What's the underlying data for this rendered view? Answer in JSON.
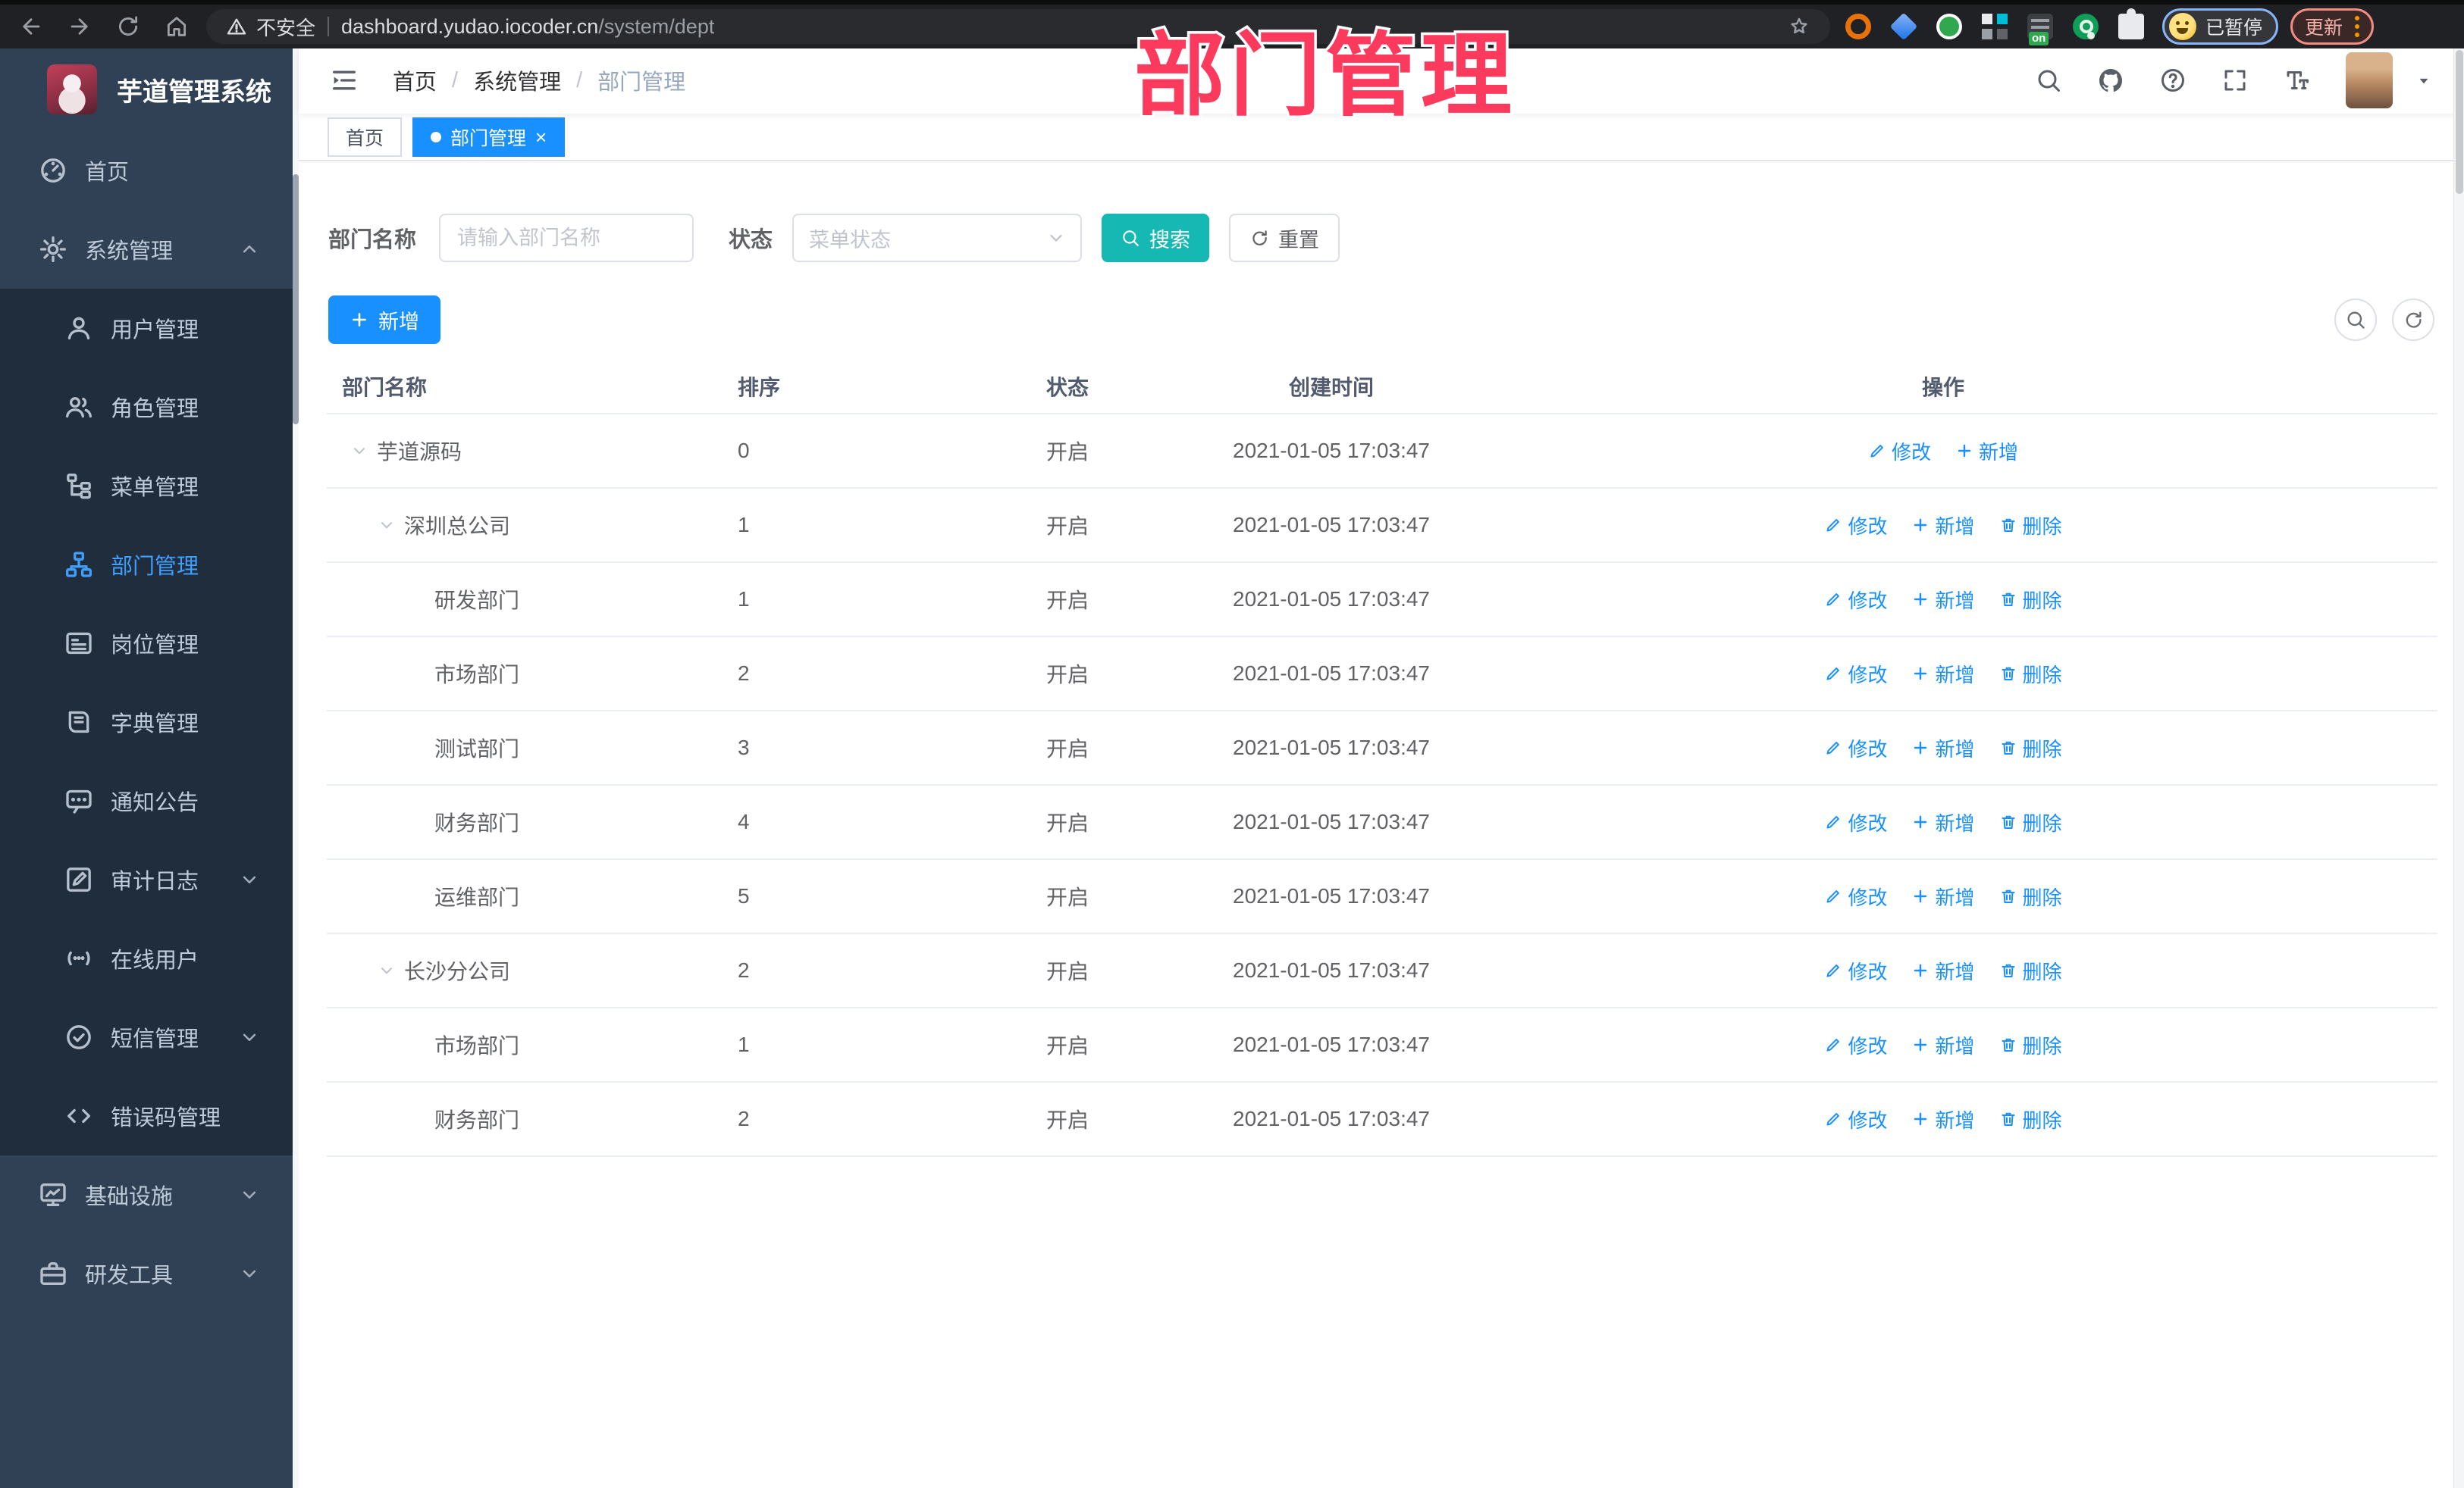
{
  "browser": {
    "security_label": "不安全",
    "url_host": "dashboard.yudao.iocoder.cn",
    "url_path": "/system/dept",
    "ext_badge": "on",
    "profile_status": "已暂停",
    "update_label": "更新"
  },
  "overlay": {
    "title": "部门管理"
  },
  "sidebar": {
    "title": "芋道管理系统",
    "items": [
      {
        "id": "home",
        "label": "首页",
        "icon": "dashboard",
        "type": "top",
        "active": false,
        "chevron": ""
      },
      {
        "id": "system",
        "label": "系统管理",
        "icon": "gear",
        "type": "top",
        "active": false,
        "chevron": "up"
      },
      {
        "id": "user",
        "label": "用户管理",
        "icon": "user",
        "type": "sub",
        "active": false,
        "chevron": ""
      },
      {
        "id": "role",
        "label": "角色管理",
        "icon": "users",
        "type": "sub",
        "active": false,
        "chevron": ""
      },
      {
        "id": "menu",
        "label": "菜单管理",
        "icon": "menutree",
        "type": "sub",
        "active": false,
        "chevron": ""
      },
      {
        "id": "dept",
        "label": "部门管理",
        "icon": "org",
        "type": "sub",
        "active": true,
        "chevron": ""
      },
      {
        "id": "post",
        "label": "岗位管理",
        "icon": "idcard",
        "type": "sub",
        "active": false,
        "chevron": ""
      },
      {
        "id": "dict",
        "label": "字典管理",
        "icon": "book",
        "type": "sub",
        "active": false,
        "chevron": ""
      },
      {
        "id": "notice",
        "label": "通知公告",
        "icon": "bubble",
        "type": "sub",
        "active": false,
        "chevron": ""
      },
      {
        "id": "audit",
        "label": "审计日志",
        "icon": "logedit",
        "type": "sub",
        "active": false,
        "chevron": "down"
      },
      {
        "id": "online",
        "label": "在线用户",
        "icon": "online",
        "type": "sub",
        "active": false,
        "chevron": ""
      },
      {
        "id": "sms",
        "label": "短信管理",
        "icon": "shieldcheck",
        "type": "sub",
        "active": false,
        "chevron": "down"
      },
      {
        "id": "errcode",
        "label": "错误码管理",
        "icon": "code",
        "type": "sub",
        "active": false,
        "chevron": ""
      },
      {
        "id": "infra",
        "label": "基础设施",
        "icon": "monitor",
        "type": "top",
        "active": false,
        "chevron": "down"
      },
      {
        "id": "tools",
        "label": "研发工具",
        "icon": "briefcase",
        "type": "top",
        "active": false,
        "chevron": "down"
      }
    ]
  },
  "header": {
    "breadcrumb": [
      "首页",
      "系统管理",
      "部门管理"
    ],
    "separator": "/"
  },
  "tags": {
    "items": [
      {
        "label": "首页",
        "active": false
      },
      {
        "label": "部门管理",
        "active": true
      }
    ],
    "close_glyph": "×"
  },
  "filter": {
    "name_label": "部门名称",
    "name_placeholder": "请输入部门名称",
    "status_label": "状态",
    "status_placeholder": "菜单状态",
    "search_label": "搜索",
    "reset_label": "重置"
  },
  "toolbar": {
    "add_label": "新增"
  },
  "table": {
    "columns": [
      "部门名称",
      "排序",
      "状态",
      "创建时间",
      "操作"
    ],
    "action_labels": {
      "edit": "修改",
      "add": "新增",
      "delete": "删除"
    },
    "rows": [
      {
        "name": "芋道源码",
        "level": 1,
        "expandable": true,
        "sort": "0",
        "status": "开启",
        "created": "2021-01-05 17:03:47",
        "actions": [
          "edit",
          "add"
        ]
      },
      {
        "name": "深圳总公司",
        "level": 2,
        "expandable": true,
        "sort": "1",
        "status": "开启",
        "created": "2021-01-05 17:03:47",
        "actions": [
          "edit",
          "add",
          "delete"
        ]
      },
      {
        "name": "研发部门",
        "level": 3,
        "expandable": false,
        "sort": "1",
        "status": "开启",
        "created": "2021-01-05 17:03:47",
        "actions": [
          "edit",
          "add",
          "delete"
        ]
      },
      {
        "name": "市场部门",
        "level": 3,
        "expandable": false,
        "sort": "2",
        "status": "开启",
        "created": "2021-01-05 17:03:47",
        "actions": [
          "edit",
          "add",
          "delete"
        ]
      },
      {
        "name": "测试部门",
        "level": 3,
        "expandable": false,
        "sort": "3",
        "status": "开启",
        "created": "2021-01-05 17:03:47",
        "actions": [
          "edit",
          "add",
          "delete"
        ]
      },
      {
        "name": "财务部门",
        "level": 3,
        "expandable": false,
        "sort": "4",
        "status": "开启",
        "created": "2021-01-05 17:03:47",
        "actions": [
          "edit",
          "add",
          "delete"
        ]
      },
      {
        "name": "运维部门",
        "level": 3,
        "expandable": false,
        "sort": "5",
        "status": "开启",
        "created": "2021-01-05 17:03:47",
        "actions": [
          "edit",
          "add",
          "delete"
        ]
      },
      {
        "name": "长沙分公司",
        "level": 2,
        "expandable": true,
        "sort": "2",
        "status": "开启",
        "created": "2021-01-05 17:03:47",
        "actions": [
          "edit",
          "add",
          "delete"
        ]
      },
      {
        "name": "市场部门",
        "level": 3,
        "expandable": false,
        "sort": "1",
        "status": "开启",
        "created": "2021-01-05 17:03:47",
        "actions": [
          "edit",
          "add",
          "delete"
        ]
      },
      {
        "name": "财务部门",
        "level": 3,
        "expandable": false,
        "sort": "2",
        "status": "开启",
        "created": "2021-01-05 17:03:47",
        "actions": [
          "edit",
          "add",
          "delete"
        ]
      }
    ]
  },
  "colors": {
    "primary": "#1890ff",
    "active_menu": "#409eff",
    "search_teal": "#15b8b2",
    "overlay_pink": "#fb3a5e",
    "sidebar_bg": "#304156",
    "submenu_bg": "#1f2d3d"
  }
}
